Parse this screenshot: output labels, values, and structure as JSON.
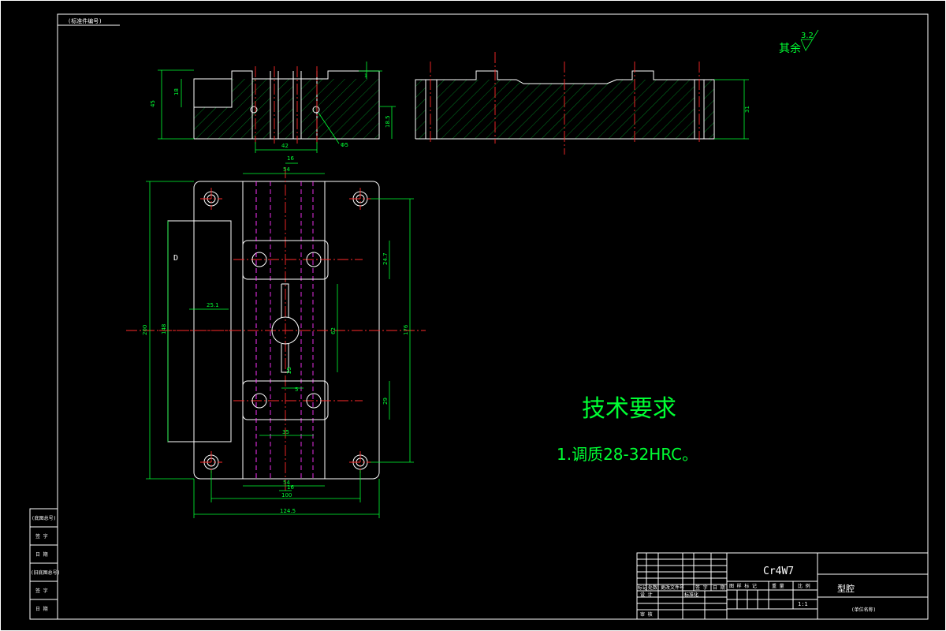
{
  "drawing": {
    "top_left_label": "(标准件编号)",
    "roughness_prefix": "其余",
    "roughness_value": "3.2",
    "tech_title": "技术要求",
    "tech_item_1": "1.调质28-32HRC。",
    "part_name": "型腔",
    "material": "Cr4W7",
    "company": "(单位名称)",
    "scale": "1:1"
  },
  "left_strip": [
    "(底图总号)",
    "签 字",
    "日 期",
    "(旧底图总号)",
    "签 字",
    "日 期"
  ],
  "title_block": {
    "row_labels_1": [
      "标记",
      "处数",
      "更改文件号",
      "签 字",
      "日 期"
    ],
    "design": "设 计",
    "standardization": "标准化",
    "review": "审 核",
    "stage_mark": "图 样 标 记",
    "weight": "重 量",
    "ratio": "比 例"
  },
  "dimensions": {
    "front_left_height": "45",
    "front_left_inner": "18",
    "front_right_height": "18.5",
    "front_bottom": "42",
    "front_hole": "Φ5",
    "front_top_right": "1",
    "side_height": "31",
    "plan_top": "54",
    "plan_top_small": "16",
    "plan_d_note": "D",
    "plan_width_left": "25.1",
    "plan_height_inner": "148",
    "plan_height_total": "200",
    "plan_slot_height": "62",
    "plan_right_total": "176",
    "plan_hole_spacing_top": "24.7",
    "plan_hole_spacing_bottom": "29",
    "plan_slot_small": "25",
    "plan_slot_bottom": "5",
    "plan_bottom_small": "54",
    "plan_bottom_16": "16",
    "plan_bottom_100": "100",
    "plan_bottom_overall": "124.5",
    "plan_mid_35": "35"
  }
}
